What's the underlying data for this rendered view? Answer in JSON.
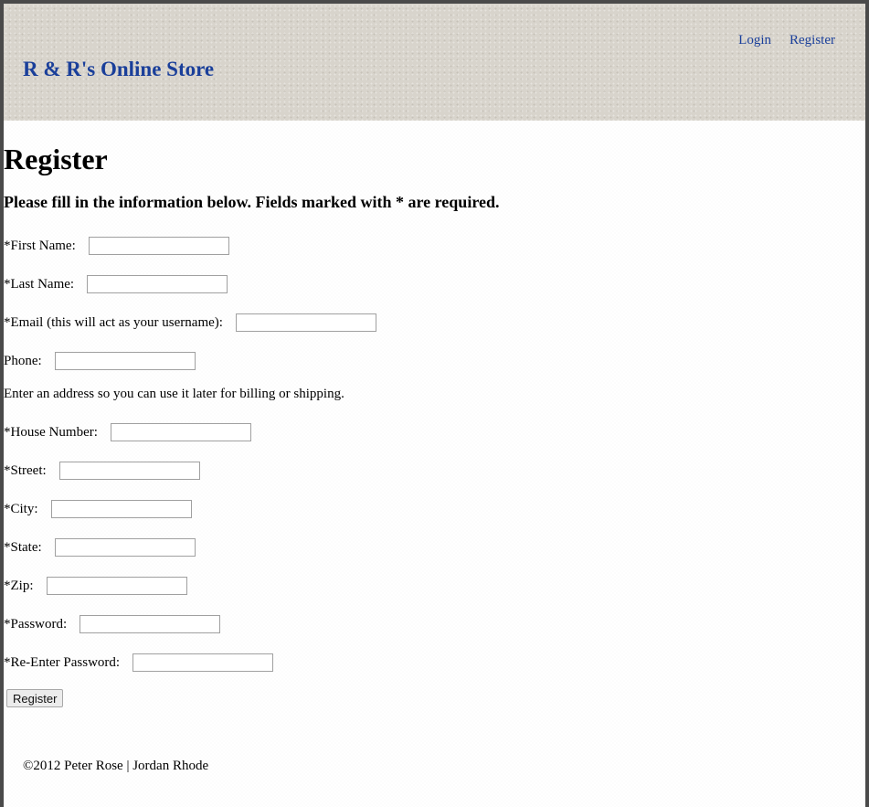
{
  "header": {
    "site_title": "R & R's Online Store",
    "nav": {
      "login": "Login",
      "register": "Register"
    }
  },
  "main": {
    "title": "Register",
    "instructions": "Please fill in the information below. Fields marked with * are required.",
    "fields": [
      {
        "label": "*First Name:",
        "value": ""
      },
      {
        "label": "*Last Name:",
        "value": ""
      },
      {
        "label": "*Email (this will act as your username):",
        "value": ""
      },
      {
        "label": "Phone:",
        "value": ""
      }
    ],
    "address_note": "Enter an address so you can use it later for billing or shipping.",
    "address_fields": [
      {
        "label": "*House Number:",
        "value": ""
      },
      {
        "label": "*Street:",
        "value": ""
      },
      {
        "label": "*City:",
        "value": ""
      },
      {
        "label": "*State:",
        "value": ""
      },
      {
        "label": "*Zip:",
        "value": ""
      }
    ],
    "password_fields": [
      {
        "label": "*Password:",
        "value": ""
      },
      {
        "label": "*Re-Enter Password:",
        "value": ""
      }
    ],
    "submit_label": "Register"
  },
  "footer": {
    "copyright": "©2012 Peter Rose | Jordan Rhode"
  },
  "colors": {
    "link": "#1a3f9a",
    "header_bg": "#d8d4cc",
    "frame_border": "#4a4a4a"
  }
}
